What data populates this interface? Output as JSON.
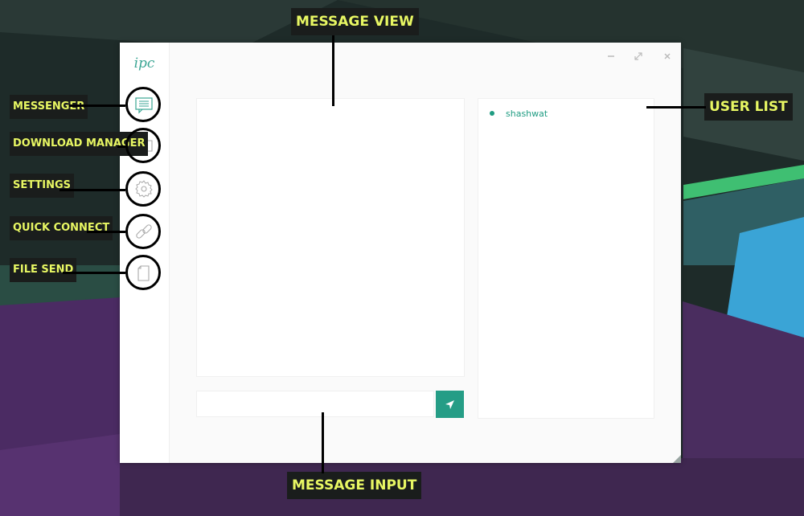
{
  "app": {
    "logo": "ipc"
  },
  "sidebar": {
    "items": [
      {
        "name": "messenger",
        "icon": "chat-icon"
      },
      {
        "name": "download-manager",
        "icon": "download-icon"
      },
      {
        "name": "settings",
        "icon": "gear-icon"
      },
      {
        "name": "quick-connect",
        "icon": "link-icon"
      },
      {
        "name": "file-send",
        "icon": "file-icon"
      }
    ]
  },
  "window_controls": [
    "minimize-icon",
    "maximize-icon",
    "close-icon"
  ],
  "message_input": {
    "value": "",
    "placeholder": ""
  },
  "send_button": {
    "icon": "send-icon"
  },
  "users": [
    {
      "name": "shashwat",
      "status": "online"
    }
  ],
  "annotations": {
    "message_view": "MESSAGE VIEW",
    "user_list": "USER LIST",
    "message_input": "MESSAGE INPUT",
    "messenger": "MESSENGER",
    "download_manager": "DOWNLOAD MANAGER",
    "settings": "SETTINGS",
    "quick_connect": "QUICK CONNECT",
    "file_send": "FILE SEND"
  },
  "colors": {
    "accent": "#259d86",
    "annotation_text": "#e8f763",
    "annotation_bg": "#1a1d1c"
  }
}
